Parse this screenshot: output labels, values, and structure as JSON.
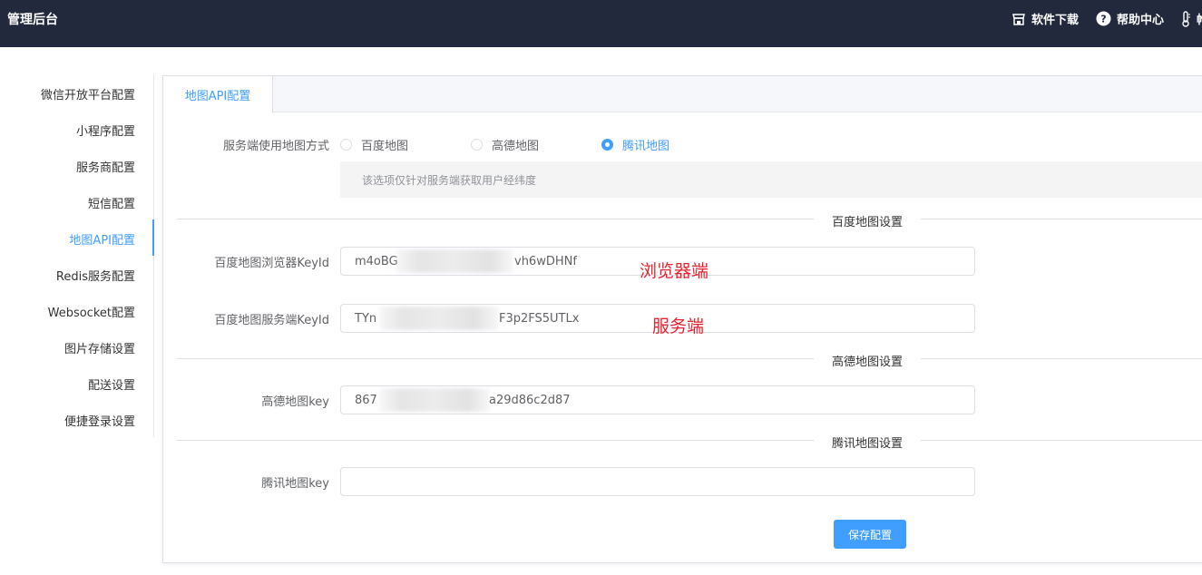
{
  "header": {
    "brand": "管理后台",
    "links": {
      "download": "软件下载",
      "help": "帮助中心",
      "third": "帷"
    }
  },
  "sidebar": {
    "items": [
      {
        "label": "微信开放平台配置"
      },
      {
        "label": "小程序配置"
      },
      {
        "label": "服务商配置"
      },
      {
        "label": "短信配置"
      },
      {
        "label": "地图API配置"
      },
      {
        "label": "Redis服务配置"
      },
      {
        "label": "Websocket配置"
      },
      {
        "label": "图片存储设置"
      },
      {
        "label": "配送设置"
      },
      {
        "label": "便捷登录设置"
      }
    ],
    "active_index": 4
  },
  "tabs": [
    {
      "label": "地图API配置"
    }
  ],
  "form": {
    "map_mode": {
      "label": "服务端使用地图方式",
      "options": [
        "百度地图",
        "高德地图",
        "腾讯地图"
      ],
      "selected": "腾讯地图",
      "hint": "该选项仅针对服务端获取用户经纬度"
    },
    "baidu_section": "百度地图设置",
    "baidu_browser_key": {
      "label": "百度地图浏览器KeyId",
      "prefix": "m4oBG",
      "suffix": "vh6wDHNf"
    },
    "baidu_server_key": {
      "label": "百度地图服务端KeyId",
      "prefix": "TYn",
      "suffix": "F3p2FS5UTLx"
    },
    "gaode_section": "高德地图设置",
    "gaode_key": {
      "label": "高德地图key",
      "prefix": "867",
      "suffix": "a29d86c2d87"
    },
    "tencent_section": "腾讯地图设置",
    "tencent_key": {
      "label": "腾讯地图key",
      "value": ""
    },
    "save_label": "保存配置"
  },
  "annotations": {
    "browser": "浏览器端",
    "server": "服务端"
  },
  "colors": {
    "header_bg": "#23293d",
    "accent": "#409eff",
    "annotation": "#e8232f"
  }
}
